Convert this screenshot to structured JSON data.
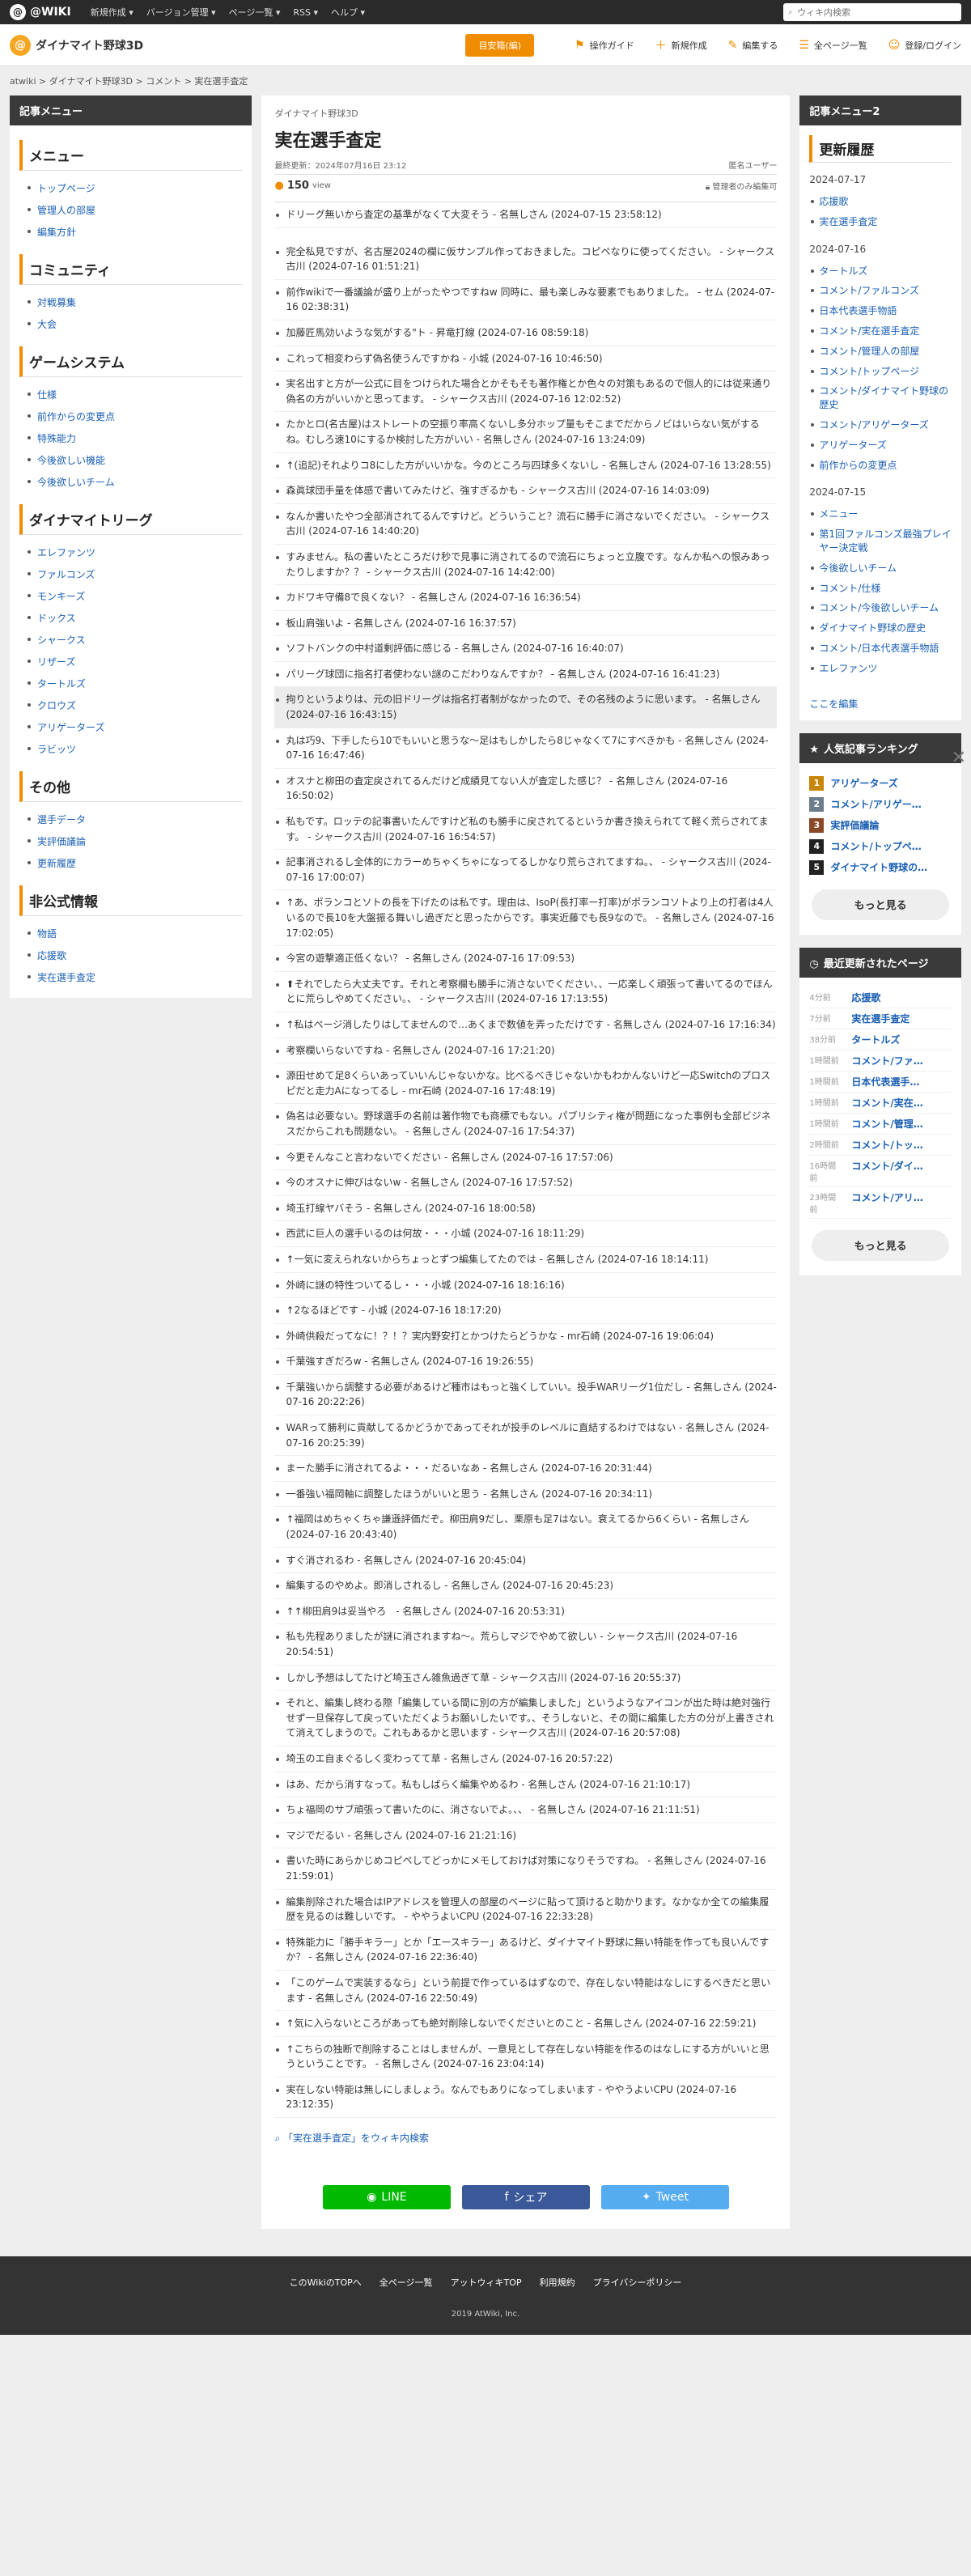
{
  "topbar": {
    "logo": "@WIKI",
    "nav": [
      "新規作成 ▾",
      "バージョン管理 ▾",
      "ページ一覧 ▾",
      "RSS ▾",
      "ヘルプ ▾"
    ],
    "search_placeholder": "ウィキ内検索"
  },
  "header": {
    "site_name": "ダイナマイト野球3D",
    "badge": "目安箱(編)",
    "actions": [
      "操作ガイド",
      "新規作成",
      "編集する",
      "全ページ一覧",
      "登録/ログイン"
    ]
  },
  "breadcrumb": "atwiki > ダイナマイト野球3D > コメント > 実在選手査定",
  "left": {
    "head": "記事メニュー",
    "sections": [
      {
        "title": "メニュー",
        "items": [
          "トップページ",
          "管理人の部屋",
          "編集方針"
        ]
      },
      {
        "title": "コミュニティ",
        "items": [
          "対戦募集",
          "大会"
        ]
      },
      {
        "title": "ゲームシステム",
        "items": [
          "仕様",
          "前作からの変更点",
          "特殊能力",
          "今後欲しい機能",
          "今後欲しいチーム"
        ]
      },
      {
        "title": "ダイナマイトリーグ",
        "items": [
          "エレファンツ",
          "ファルコンズ",
          "モンキーズ",
          "ドックス",
          "シャークス",
          "リザーズ",
          "タートルズ",
          "クロウズ",
          "アリゲーターズ",
          "ラビッツ"
        ]
      },
      {
        "title": "その他",
        "items": [
          "選手データ",
          "実評価議論",
          "更新履歴"
        ]
      },
      {
        "title": "非公式情報",
        "items": [
          "物語",
          "応援歌",
          "実在選手査定"
        ]
      }
    ]
  },
  "main": {
    "site_small": "ダイナマイト野球3D",
    "title": "実在選手査定",
    "updated": "最終更新：2024年07月16日 23:12",
    "author": "匿名ユーザー",
    "views_num": "150",
    "views_unit": "view",
    "lock": "管理者のみ編集可",
    "comments": [
      "ドリーグ無いから査定の基準がなくて大変そう - 名無しさん (2024-07-15 23:58:12)",
      "完全私見ですが、名古屋2024の欄に仮サンプル作っておきました。コピペなりに使ってください。 - シャークス古川 (2024-07-16 01:51:21)",
      "前作wikiで一番議論が盛り上がったやつですねw 同時に、最も楽しみな要素でもありました。 - セム (2024-07-16 02:38:31)",
      "加藤匠馬効いような気がする\"ト - 昇竜打線 (2024-07-16 08:59:18)",
      "これって相変わらず偽名使うんですかね - 小城 (2024-07-16 10:46:50)",
      "実名出すと方が一公式に目をつけられた場合とかそもそも著作権とか色々の対策もあるので個人的には従来通り偽名の方がいいかと思ってます。 - シャークス古川 (2024-07-16 12:02:52)",
      "たかとロ(名古屋)はストレートの空振り率高くないし多分ホップ量もそこまでだからノビはいらない気がするね。むしろ速10にするか検討した方がいい - 名無しさん (2024-07-16 13:24:09)",
      "↑(追記)それよりコ8にした方がいいかな。今のところ与四球多くないし - 名無しさん (2024-07-16 13:28:55)",
      "森眞球団手量を体感で書いてみたけど、強すぎるかも - シャークス古川 (2024-07-16 14:03:09)",
      "なんか書いたやつ全部消されてるんですけど。どういうこと？流石に勝手に消さないでください。 - シャークス古川 (2024-07-16 14:40:20)",
      "すみません。私の書いたところだけ秒で見事に消されてるので流石にちょっと立腹です。なんか私への恨みあったりしますか？？ - シャークス古川 (2024-07-16 14:42:00)",
      "カドワキ守備8で良くない？ - 名無しさん (2024-07-16 16:36:54)",
      "板山肩強いよ - 名無しさん (2024-07-16 16:37:57)",
      "ソフトバンクの中村道剰評価に感じる - 名無しさん (2024-07-16 16:40:07)",
      "パリーグ球団に指名打者使わない謎のこだわりなんですか？ - 名無しさん (2024-07-16 16:41:23)",
      "拘りというよりは、元の旧ドリーグは指名打者制がなかったので、その名残のように思います。 - 名無しさん (2024-07-16 16:43:15)",
      "丸は巧9、下手したら10でもいいと思うな〜足はもしかしたら8じゃなくて7にすべきかも - 名無しさん (2024-07-16 16:47:46)",
      "オスナと柳田の査定戻されてるんだけど成績見てない人が査定した感じ？ - 名無しさん (2024-07-16 16:50:02)",
      "私もです。ロッテの記事書いたんですけど私のも勝手に戻されてるというか書き換えられてて軽く荒らされてます。 - シャークス古川 (2024-07-16 16:54:57)",
      "記事消されるし全体的にカラーめちゃくちゃになってるしかなり荒らされてますね。、 - シャークス古川 (2024-07-16 17:00:07)",
      "↑あ、ポランコとソトの長を下げたのは私です。理由は、IsoP(長打率ー打率)がポランコソトより上の打者は4人いるので長10を大盤振る舞いし過ぎだと思ったからです。事実近藤でも長9なので。 - 名無しさん (2024-07-16 17:02:05)",
      "今宮の遊撃適正低くない？ - 名無しさん (2024-07-16 17:09:53)",
      "⬆それでしたら大丈夫です。それと考察欄も勝手に消さないでください、、一応楽しく頑張って書いてるのでほんとに荒らしやめてください。、 - シャークス古川 (2024-07-16 17:13:55)",
      "↑私はページ消したりはしてませんので…あくまで数値を弄っただけです - 名無しさん (2024-07-16 17:16:34)",
      "考察欄いらないですね - 名無しさん (2024-07-16 17:21:20)",
      "源田せめて足8くらいあっていいんじゃないかな。比べるべきじゃないかもわかんないけど一応Switchのプロスピだと走力Aになってるし - mr石崎 (2024-07-16 17:48:19)",
      "偽名は必要ない。野球選手の名前は著作物でも商標でもない。パブリシティ権が問題になった事例も全部ビジネスだからこれも問題ない。 - 名無しさん (2024-07-16 17:54:37)",
      "今更そんなこと言わないでください - 名無しさん (2024-07-16 17:57:06)",
      "今のオスナに伸びはないw - 名無しさん (2024-07-16 17:57:52)",
      "埼玉打線ヤバそう - 名無しさん (2024-07-16 18:00:58)",
      "西武に巨人の選手いるのは何故・・・小城 (2024-07-16 18:11:29)",
      "↑一気に変えられないからちょっとずつ編集してたのでは - 名無しさん (2024-07-16 18:14:11)",
      "外崎に謎の特性ついてるし・・・小城 (2024-07-16 18:16:16)",
      "↑2なるほどです - 小城 (2024-07-16 18:17:20)",
      "外崎供殺だってなに！？！？実内野安打とかつけたらどうかな - mr石崎 (2024-07-16 19:06:04)",
      "千葉強すぎだろw - 名無しさん (2024-07-16 19:26:55)",
      "千葉強いから調整する必要があるけど種市はもっと強くしていい。投手WARリーグ1位だし - 名無しさん (2024-07-16 20:22:26)",
      "WARって勝利に貢献してるかどうかであってそれが投手のレベルに直結するわけではない - 名無しさん (2024-07-16 20:25:39)",
      "まーた勝手に消されてるよ・・・だるいなあ - 名無しさん (2024-07-16 20:31:44)",
      "一番強い福岡軸に調整したほうがいいと思う - 名無しさん (2024-07-16 20:34:11)",
      "↑福岡はめちゃくちゃ謙遜評価だぞ。柳田肩9だし、栗原も足7はない。衰えてるから6くらい - 名無しさん (2024-07-16 20:43:40)",
      "すぐ消されるわ - 名無しさん (2024-07-16 20:45:04)",
      "編集するのやめよ。即消しされるし - 名無しさん (2024-07-16 20:45:23)",
      "↑↑柳田肩9は妥当やろ　- 名無しさん (2024-07-16 20:53:31)",
      "私も先程ありましたが謎に消されますね〜。荒らしマジでやめて欲しい - シャークス古川 (2024-07-16 20:54:51)",
      "しかし予想はしてたけど埼玉さん雑魚過ぎて草 - シャークス古川 (2024-07-16 20:55:37)",
      "それと、編集し終わる際「編集している間に別の方が編集しました」というようなアイコンが出た時は絶対強行せず一旦保存して戻っていただくようお願いしたいです。、そうしないと、その間に編集した方の分が上書きされて消えてしまうので。これもあるかと思います - シャークス古川 (2024-07-16 20:57:08)",
      "埼玉のエ自まぐるしく変わってて草 - 名無しさん (2024-07-16 20:57:22)",
      "はあ、だから消すなって。私もしばらく編集やめるわ - 名無しさん (2024-07-16 21:10:17)",
      "ちょ福岡のサブ頑張って書いたのに、消さないでよ。、、 - 名無しさん (2024-07-16 21:11:51)",
      "マジでだるい - 名無しさん (2024-07-16 21:21:16)",
      "書いた時にあらかじめコピペしてどっかにメモしておけば対策になりそうですね。 - 名無しさん (2024-07-16 21:59:01)",
      "編集削除された場合はIPアドレスを管理人の部屋のページに貼って頂けると助かります。なかなか全ての編集履歴を見るのは難しいです。 - ややうよいCPU (2024-07-16 22:33:28)",
      "特殊能力に「勝手キラー」とか「エースキラー」あるけど、ダイナマイト野球に無い特能を作っても良いんですか？ - 名無しさん (2024-07-16 22:36:40)",
      "「このゲームで実装するなら」という前提で作っているはずなので、存在しない特能はなしにするべきだと思います - 名無しさん (2024-07-16 22:50:49)",
      "↑気に入らないところがあっても絶対削除しないでくださいとのこと - 名無しさん (2024-07-16 22:59:21)",
      "↑こちらの独断で削除することはしませんが、一意見として存在しない特能を作るのはなしにする方がいいと思うということです。 - 名無しさん (2024-07-16 23:04:14)",
      "実在しない特能は無しにしましょう。なんでもありになってしまいます - ややうよいCPU (2024-07-16 23:12:35)"
    ],
    "wiki_search": "「実在選手査定」をウィキ内検索",
    "share": [
      "LINE",
      "シェア",
      "Tweet"
    ]
  },
  "right": {
    "menu2_head": "記事メニュー2",
    "history_title": "更新履歴",
    "history": [
      {
        "date": "2024-07-17",
        "items": [
          "応援歌",
          "実在選手査定"
        ]
      },
      {
        "date": "2024-07-16",
        "items": [
          "タートルズ",
          "コメント/ファルコンズ",
          "日本代表選手物語",
          "コメント/実在選手査定",
          "コメント/管理人の部屋",
          "コメント/トップページ",
          "コメント/ダイナマイト野球の歴史",
          "コメント/アリゲーターズ",
          "アリゲーターズ",
          "前作からの変更点"
        ]
      },
      {
        "date": "2024-07-15",
        "items": [
          "メニュー",
          "第1回ファルコンズ最強プレイヤー決定戦",
          "今後欲しいチーム",
          "コメント/仕様",
          "コメント/今後欲しいチーム",
          "ダイナマイト野球の歴史",
          "コメント/日本代表選手物語",
          "エレファンツ"
        ]
      }
    ],
    "edit_here": "ここを編集",
    "ranking_head": "人気記事ランキング",
    "ranking": [
      "アリゲーターズ",
      "コメント/アリゲー…",
      "実評価議論",
      "コメント/トップペ…",
      "ダイナマイト野球の…"
    ],
    "more": "もっと見る",
    "recent_head": "最近更新されたページ",
    "recent": [
      {
        "t": "4分前",
        "p": "応援歌"
      },
      {
        "t": "7分前",
        "p": "実在選手査定"
      },
      {
        "t": "38分前",
        "p": "タートルズ"
      },
      {
        "t": "1時間前",
        "p": "コメント/ファ…"
      },
      {
        "t": "1時間前",
        "p": "日本代表選手…"
      },
      {
        "t": "1時間前",
        "p": "コメント/実在…"
      },
      {
        "t": "1時間前",
        "p": "コメント/管理…"
      },
      {
        "t": "2時間前",
        "p": "コメント/トッ…"
      },
      {
        "t": "16時間前",
        "p": "コメント/ダイ…"
      },
      {
        "t": "23時間前",
        "p": "コメント/アリ…"
      }
    ]
  },
  "footer": {
    "links": [
      "このWikiのTOPへ",
      "全ページ一覧",
      "アットウィキTOP",
      "利用規約",
      "プライバシーポリシー"
    ],
    "copyright": "2019 AtWiki, Inc."
  },
  "colors": {
    "accent": "#f08c00",
    "rank": [
      "#c8860a",
      "#6d7d8b",
      "#8a4a2a",
      "#222222",
      "#222222"
    ],
    "share": [
      "#00b900",
      "#3b5998",
      "#55acee"
    ]
  }
}
